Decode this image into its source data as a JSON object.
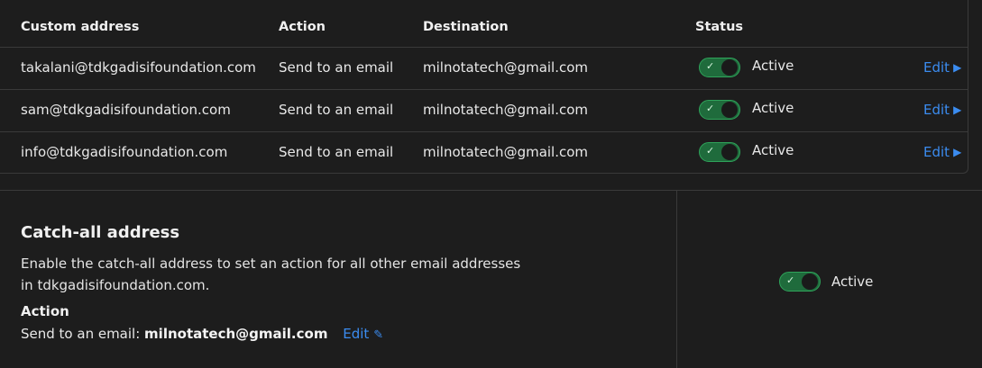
{
  "table": {
    "headers": {
      "custom_address": "Custom address",
      "action": "Action",
      "destination": "Destination",
      "status": "Status"
    },
    "rows": [
      {
        "address": "takalani@tdkgadisifoundation.com",
        "action": "Send to an email",
        "destination": "milnotatech@gmail.com",
        "status": "Active",
        "edit": "Edit"
      },
      {
        "address": "sam@tdkgadisifoundation.com",
        "action": "Send to an email",
        "destination": "milnotatech@gmail.com",
        "status": "Active",
        "edit": "Edit"
      },
      {
        "address": "info@tdkgadisifoundation.com",
        "action": "Send to an email",
        "destination": "milnotatech@gmail.com",
        "status": "Active",
        "edit": "Edit"
      }
    ]
  },
  "catchall": {
    "title": "Catch-all address",
    "description": "Enable the catch-all address to set an action for all other email addresses in tdkgadisifoundation.com.",
    "action_heading": "Action",
    "action_prefix": "Send to an email:",
    "action_destination": "milnotatech@gmail.com",
    "edit": "Edit",
    "status": "Active"
  },
  "icons": {
    "toggle_check": "check-icon",
    "edit_arrow": "caret-right-icon",
    "edit_pencil": "pencil-icon"
  },
  "colors": {
    "background": "#1d1d1d",
    "accent_link": "#3b8cf0",
    "toggle_on": "#1f6b3c",
    "toggle_border": "#2fa35a"
  }
}
